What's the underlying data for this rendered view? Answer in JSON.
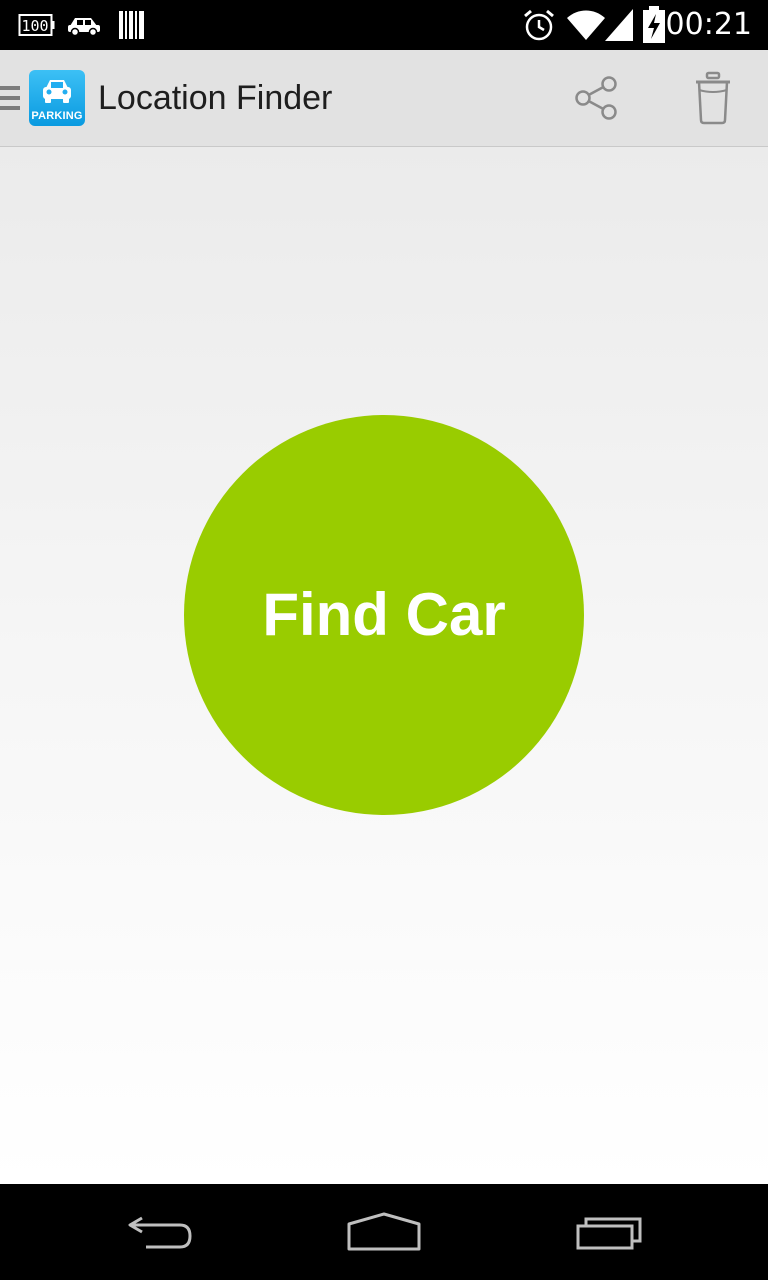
{
  "status_bar": {
    "battery_notification_text": "100",
    "time": "00:21"
  },
  "action_bar": {
    "app_icon_label": "PARKING",
    "title": "Location Finder"
  },
  "main": {
    "find_car_label": "Find Car"
  },
  "colors": {
    "status_bar_bg": "#000000",
    "action_bar_bg": "#e2e2e2",
    "accent_green": "#99cc00",
    "app_icon_blue": "#0a9ae0",
    "nav_bar_bg": "#000000"
  },
  "icons": {
    "status_left": [
      "battery-100-notification-icon",
      "car-notification-icon",
      "barcode-notification-icon"
    ],
    "status_right": [
      "alarm-icon",
      "wifi-icon",
      "signal-icon",
      "battery-charging-icon"
    ],
    "action_bar": [
      "share-icon",
      "trash-icon"
    ],
    "nav_bar": [
      "back-icon",
      "home-icon",
      "recents-icon"
    ]
  }
}
